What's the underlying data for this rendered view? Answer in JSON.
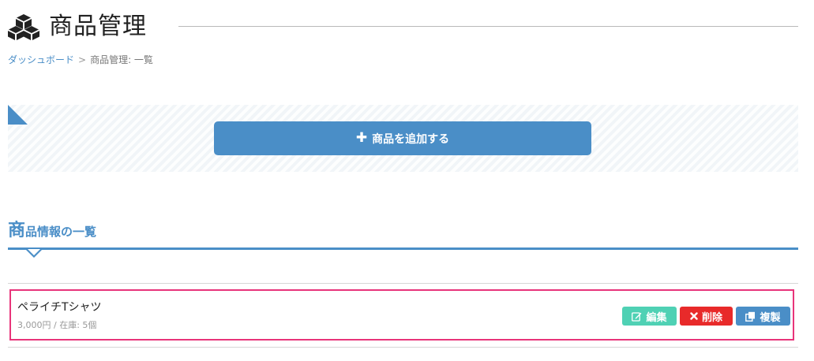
{
  "header": {
    "title": "商品管理",
    "icon": "cubes-icon"
  },
  "breadcrumb": {
    "home": "ダッシュボード",
    "separator": ">",
    "current": "商品管理: 一覧"
  },
  "add_panel": {
    "add_label": "商品を追加する",
    "icon": "plus-icon"
  },
  "section": {
    "heading_first": "商",
    "heading_rest": "品情報の一覧"
  },
  "products": [
    {
      "name": "ペライチTシャツ",
      "meta": "3,000円 / 在庫: 5個",
      "edit_label": "編集",
      "delete_label": "削除",
      "copy_label": "複製"
    }
  ],
  "colors": {
    "accent": "#4a8ec7",
    "edit": "#4fd1b4",
    "delete": "#e82a2a",
    "highlight": "#e8347a"
  }
}
